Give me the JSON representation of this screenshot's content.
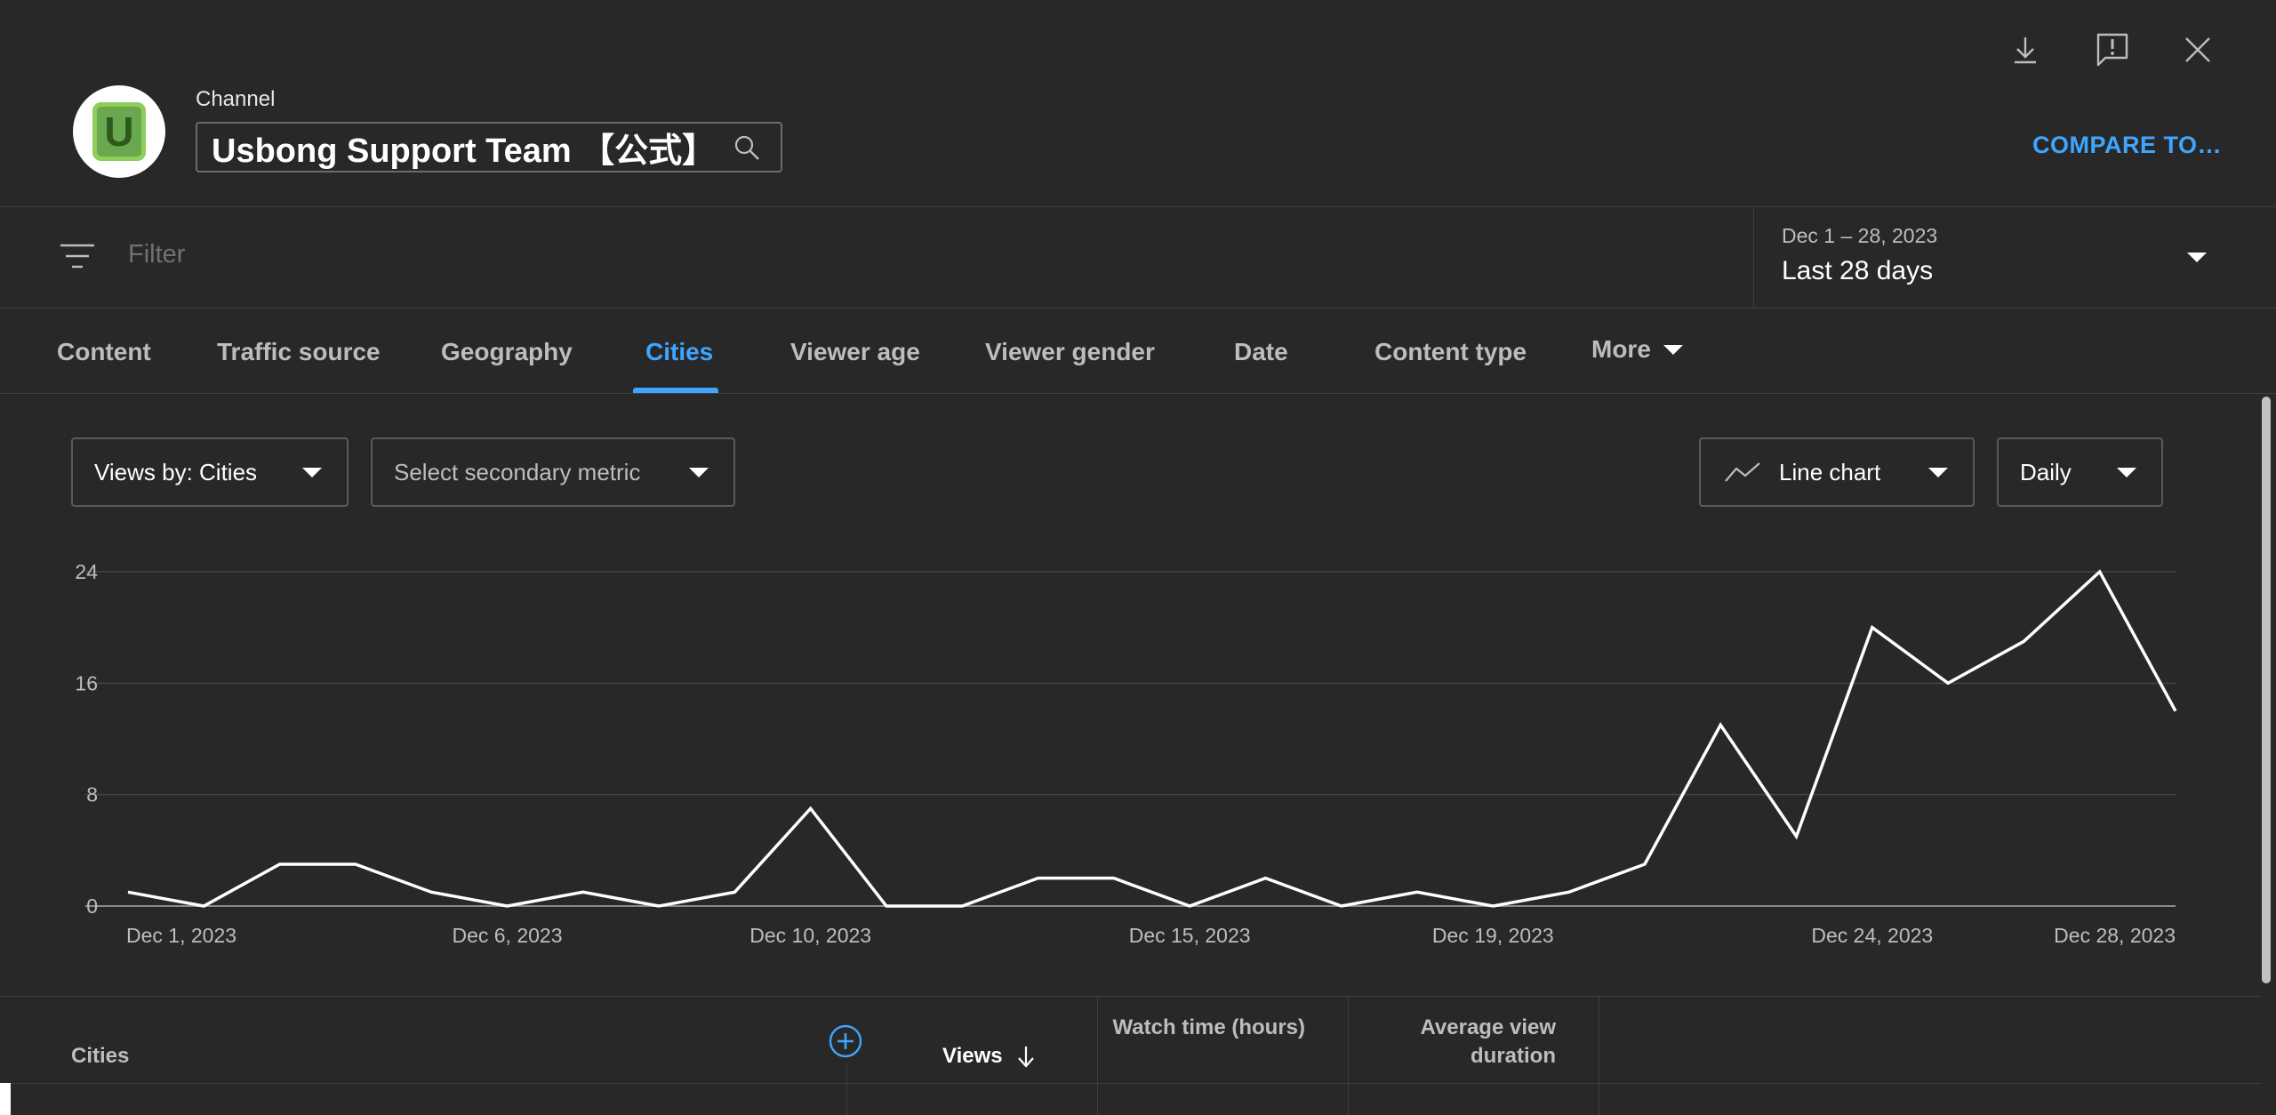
{
  "header": {
    "channel_label": "Channel",
    "channel_name": "Usbong Support Team 【公式】",
    "compare_label": "COMPARE TO…",
    "icons": [
      "download-icon",
      "feedback-icon",
      "close-icon"
    ]
  },
  "filter": {
    "placeholder": "Filter",
    "date_range": "Dec 1 – 28, 2023",
    "date_label": "Last 28 days"
  },
  "tabs": [
    {
      "label": "Content"
    },
    {
      "label": "Traffic source"
    },
    {
      "label": "Geography"
    },
    {
      "label": "Cities",
      "active": true
    },
    {
      "label": "Viewer age"
    },
    {
      "label": "Viewer gender"
    },
    {
      "label": "Date"
    },
    {
      "label": "Content type"
    },
    {
      "label": "More"
    }
  ],
  "controls": {
    "primary_metric": "Views by: Cities",
    "secondary_metric": "Select secondary metric",
    "chart_type": "Line chart",
    "granularity": "Daily"
  },
  "chart_data": {
    "type": "line",
    "x": [
      "Dec 1, 2023",
      "Dec 2, 2023",
      "Dec 3, 2023",
      "Dec 4, 2023",
      "Dec 5, 2023",
      "Dec 6, 2023",
      "Dec 7, 2023",
      "Dec 8, 2023",
      "Dec 9, 2023",
      "Dec 10, 2023",
      "Dec 11, 2023",
      "Dec 12, 2023",
      "Dec 13, 2023",
      "Dec 14, 2023",
      "Dec 15, 2023",
      "Dec 16, 2023",
      "Dec 17, 2023",
      "Dec 18, 2023",
      "Dec 19, 2023",
      "Dec 20, 2023",
      "Dec 21, 2023",
      "Dec 22, 2023",
      "Dec 23, 2023",
      "Dec 24, 2023",
      "Dec 25, 2023",
      "Dec 26, 2023",
      "Dec 27, 2023",
      "Dec 28, 2023"
    ],
    "series": [
      {
        "values": [
          1,
          0,
          3,
          3,
          1,
          0,
          1,
          0,
          1,
          7,
          0,
          0,
          2,
          2,
          0,
          2,
          0,
          1,
          0,
          1,
          3,
          13,
          5,
          20,
          16,
          19,
          24,
          14
        ]
      }
    ],
    "x_tick_labels": [
      "Dec 1, 2023",
      "Dec 6, 2023",
      "Dec 10, 2023",
      "Dec 15, 2023",
      "Dec 19, 2023",
      "Dec 24, 2023",
      "Dec 28, 2023"
    ],
    "y_ticks": [
      0,
      8,
      16,
      24
    ],
    "ylim": [
      0,
      24
    ],
    "grid": true,
    "line_color": "#ffffff"
  },
  "table": {
    "columns": [
      "Cities",
      "Views",
      "Watch time (hours)",
      "Average view duration"
    ],
    "sort_column": "Views"
  },
  "colors": {
    "background": "#282828",
    "accent": "#3ea6ff"
  }
}
